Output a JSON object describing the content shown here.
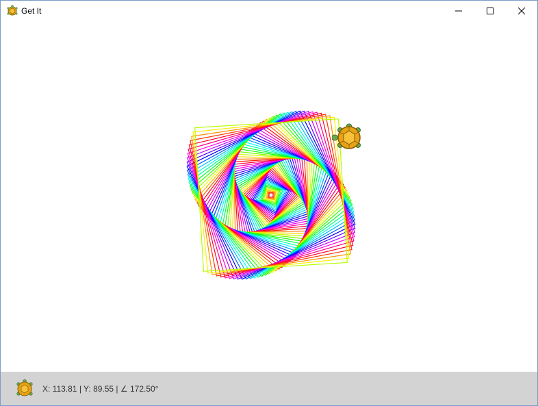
{
  "window": {
    "title": "Get It",
    "app_icon": "turtle-icon",
    "controls": {
      "minimize": "minimize-icon",
      "maximize": "maximize-icon",
      "close": "close-icon"
    }
  },
  "canvas": {
    "drawing": "rainbow-spiral-squares",
    "turtle_icon": "turtle-icon",
    "colors": [
      "#ff0000",
      "#ff8000",
      "#ffff00",
      "#00ff00",
      "#00ffff",
      "#0000ff",
      "#8000ff",
      "#ff00ff"
    ]
  },
  "status": {
    "icon": "turtle-icon",
    "text": "X: 113.81 | Y: 89.55 | ∠ 172.50°"
  }
}
